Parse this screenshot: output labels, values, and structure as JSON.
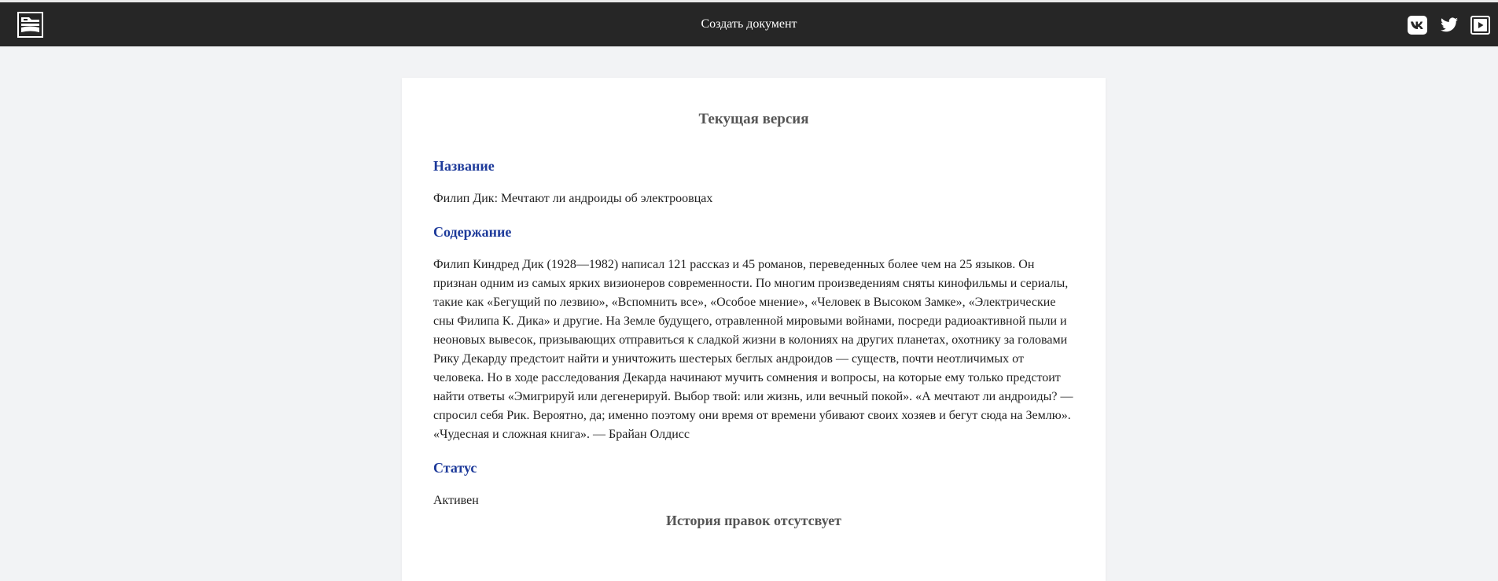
{
  "navbar": {
    "title": "Создать документ",
    "logo_icon": "book-stack-logo-icon",
    "social": [
      {
        "name": "vk-icon"
      },
      {
        "name": "twitter-icon"
      },
      {
        "name": "youtube-icon"
      }
    ],
    "background": "#262626"
  },
  "document": {
    "version_title": "Текущая версия",
    "name_heading": "Название",
    "name_value": "Филип Дик: Мечтают ли андроиды об электроовцах",
    "content_heading": "Содержание",
    "content_value": "Филип Киндред Дик (1928—1982) написал 121 рассказ и 45 романов, переведенных более чем на 25 языков. Он признан одним из самых ярких визионеров современности. По многим произведениям сняты кинофильмы и сериалы, такие как «Бегущий по лезвию», «Вспомнить все», «Особое мнение», «Человек в Высоком Замке», «Электрические сны Филипа К. Дика» и другие. На Земле будущего, отравленной мировыми войнами, посреди радиоактивной пыли и неоновых вывесок, призывающих отправиться к сладкой жизни в колониях на других планетах, охотнику за головами Рику Декарду предстоит найти и уничтожить шестерых беглых андроидов — существ, почти неотличимых от человека. Но в ходе расследования Декарда начинают мучить сомнения и вопросы, на которые ему только предстоит найти ответы «Эмигрируй или дегенерируй. Выбор твой: или жизнь, или вечный покой». «А мечтают ли андроиды? — спросил себя Рик. Вероятно, да; именно поэтому они время от времени убивают своих хозяев и бегут сюда на Землю». «Чудесная и сложная книга». — Брайан Олдисс",
    "status_heading": "Статус",
    "status_value": "Активен",
    "history_text": "История правок отсутсвует"
  },
  "colors": {
    "heading_accent": "#1d3a9a",
    "page_background": "#f2f3f5"
  }
}
